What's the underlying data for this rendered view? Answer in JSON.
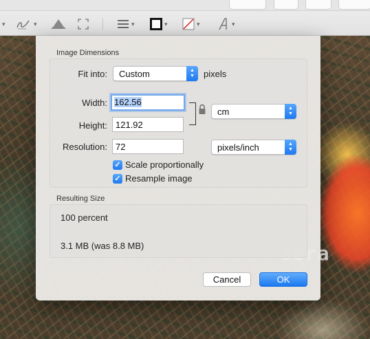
{
  "photo": {
    "watermark": "sora"
  },
  "toolbar": {
    "icons": [
      "sketch-icon",
      "adjust-color-icon",
      "resize-icon",
      "shape-style-icon",
      "border-color-icon",
      "fill-color-icon",
      "text-style-icon"
    ]
  },
  "dialog": {
    "image_dimensions_title": "Image Dimensions",
    "fit_into_label": "Fit into:",
    "fit_into_value": "Custom",
    "fit_into_unit": "pixels",
    "width_label": "Width:",
    "width_value": "162.56",
    "height_label": "Height:",
    "height_value": "121.92",
    "size_unit": "cm",
    "resolution_label": "Resolution:",
    "resolution_value": "72",
    "resolution_unit": "pixels/inch",
    "scale_proportionally_label": "Scale proportionally",
    "scale_proportionally_checked": true,
    "resample_label": "Resample image",
    "resample_checked": true,
    "resulting_size_title": "Resulting Size",
    "resulting_percent": "100 percent",
    "resulting_size": "3.1 MB (was 8.8 MB)",
    "cancel_label": "Cancel",
    "ok_label": "OK"
  },
  "colors": {
    "accent": "#1f79f0",
    "focus_ring": "#6ea7ec",
    "selection": "#b3d3fb"
  }
}
